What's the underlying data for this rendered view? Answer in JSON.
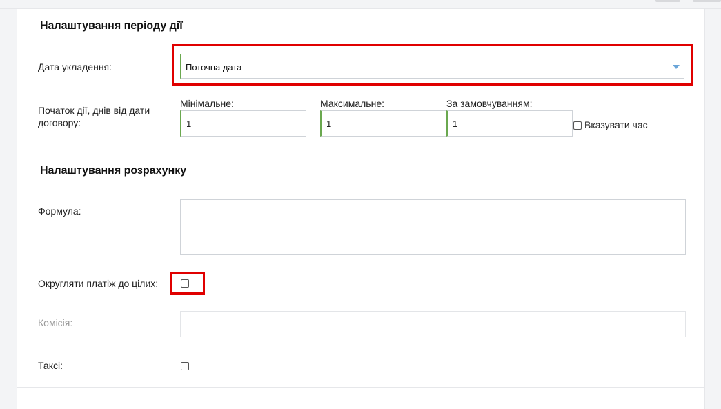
{
  "period_section": {
    "title": "Налаштування періоду дії",
    "contract_date_label": "Дата укладення:",
    "contract_date_value": "Поточна дата",
    "start_label": "Початок дії, днів від дати договору:",
    "min_label": "Мінімальне:",
    "min_value": "1",
    "max_label": "Максимальне:",
    "max_value": "1",
    "default_label": "За замовчуванням:",
    "default_value": "1",
    "show_time_label": "Вказувати час"
  },
  "calc_section": {
    "title": "Налаштування розрахунку",
    "formula_label": "Формула:",
    "formula_value": "",
    "round_label": "Округляти платіж до цілих:",
    "commission_label": "Комісія:",
    "commission_value": "",
    "taxi_label": "Таксі:"
  },
  "colors": {
    "highlight": "#e00000",
    "valid_border": "#6aa84f",
    "caret": "#6aa5d8"
  }
}
